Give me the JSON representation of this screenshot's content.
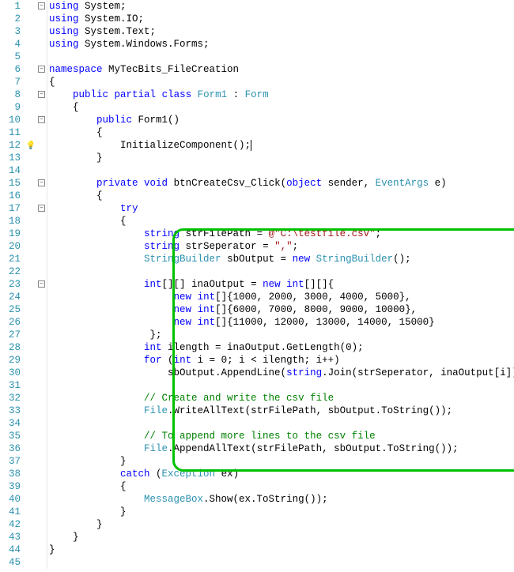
{
  "lines": [
    {
      "n": 1,
      "fold": "-",
      "code": [
        [
          "kw",
          "using"
        ],
        [
          "",
          " System;"
        ]
      ]
    },
    {
      "n": 2,
      "fold": "",
      "code": [
        [
          "kw",
          "using"
        ],
        [
          "",
          " System.IO;"
        ]
      ]
    },
    {
      "n": 3,
      "fold": "",
      "code": [
        [
          "kw",
          "using"
        ],
        [
          "",
          " System.Text;"
        ]
      ]
    },
    {
      "n": 4,
      "fold": "",
      "code": [
        [
          "kw",
          "using"
        ],
        [
          "",
          " System.Windows.Forms;"
        ]
      ]
    },
    {
      "n": 5,
      "fold": "",
      "code": [
        [
          "",
          ""
        ]
      ]
    },
    {
      "n": 6,
      "fold": "-",
      "code": [
        [
          "kw",
          "namespace"
        ],
        [
          "",
          " MyTecBits_FileCreation"
        ]
      ]
    },
    {
      "n": 7,
      "fold": "",
      "code": [
        [
          "",
          "{"
        ]
      ]
    },
    {
      "n": 8,
      "fold": "-",
      "code": [
        [
          "",
          "    "
        ],
        [
          "kw",
          "public"
        ],
        [
          "",
          " "
        ],
        [
          "kw",
          "partial"
        ],
        [
          "",
          " "
        ],
        [
          "kw",
          "class"
        ],
        [
          "",
          " "
        ],
        [
          "type",
          "Form1"
        ],
        [
          "",
          " : "
        ],
        [
          "type",
          "Form"
        ]
      ]
    },
    {
      "n": 9,
      "fold": "",
      "code": [
        [
          "",
          "    {"
        ]
      ]
    },
    {
      "n": 10,
      "fold": "-",
      "code": [
        [
          "",
          "        "
        ],
        [
          "kw",
          "public"
        ],
        [
          "",
          " Form1()"
        ]
      ]
    },
    {
      "n": 11,
      "fold": "",
      "code": [
        [
          "",
          "        {"
        ]
      ]
    },
    {
      "n": 12,
      "fold": "",
      "marker": "bulb",
      "code": [
        [
          "",
          "            InitializeComponent();"
        ],
        [
          "caret",
          ""
        ]
      ]
    },
    {
      "n": 13,
      "fold": "",
      "code": [
        [
          "",
          "        }"
        ]
      ]
    },
    {
      "n": 14,
      "fold": "",
      "code": [
        [
          "",
          ""
        ]
      ]
    },
    {
      "n": 15,
      "fold": "-",
      "code": [
        [
          "",
          "        "
        ],
        [
          "kw",
          "private"
        ],
        [
          "",
          " "
        ],
        [
          "kw",
          "void"
        ],
        [
          "",
          " btnCreateCsv_Click("
        ],
        [
          "kw",
          "object"
        ],
        [
          "",
          " sender, "
        ],
        [
          "type",
          "EventArgs"
        ],
        [
          "",
          " e)"
        ]
      ]
    },
    {
      "n": 16,
      "fold": "",
      "code": [
        [
          "",
          "        {"
        ]
      ]
    },
    {
      "n": 17,
      "fold": "-",
      "code": [
        [
          "",
          "            "
        ],
        [
          "kw",
          "try"
        ]
      ]
    },
    {
      "n": 18,
      "fold": "",
      "code": [
        [
          "",
          "            {"
        ]
      ]
    },
    {
      "n": 19,
      "fold": "",
      "code": [
        [
          "",
          "                "
        ],
        [
          "kw",
          "string"
        ],
        [
          "",
          " strFilePath = "
        ],
        [
          "str",
          "@\"C:\\testfile.csv\""
        ],
        [
          "",
          ";"
        ]
      ]
    },
    {
      "n": 20,
      "fold": "",
      "code": [
        [
          "",
          "                "
        ],
        [
          "kw",
          "string"
        ],
        [
          "",
          " strSeperator = "
        ],
        [
          "str",
          "\",\""
        ],
        [
          "",
          ";"
        ]
      ]
    },
    {
      "n": 21,
      "fold": "",
      "code": [
        [
          "",
          "                "
        ],
        [
          "type",
          "StringBuilder"
        ],
        [
          "",
          " sbOutput = "
        ],
        [
          "kw",
          "new"
        ],
        [
          "",
          " "
        ],
        [
          "type",
          "StringBuilder"
        ],
        [
          "",
          "();"
        ]
      ]
    },
    {
      "n": 22,
      "fold": "",
      "code": [
        [
          "",
          ""
        ]
      ]
    },
    {
      "n": 23,
      "fold": "-",
      "code": [
        [
          "",
          "                "
        ],
        [
          "kw",
          "int"
        ],
        [
          "",
          "[][] inaOutput = "
        ],
        [
          "kw",
          "new"
        ],
        [
          "",
          " "
        ],
        [
          "kw",
          "int"
        ],
        [
          "",
          "[][]{"
        ]
      ]
    },
    {
      "n": 24,
      "fold": "",
      "code": [
        [
          "",
          "                     "
        ],
        [
          "kw",
          "new"
        ],
        [
          "",
          " "
        ],
        [
          "kw",
          "int"
        ],
        [
          "",
          "[]{1000, 2000, 3000, 4000, 5000},"
        ]
      ]
    },
    {
      "n": 25,
      "fold": "",
      "code": [
        [
          "",
          "                     "
        ],
        [
          "kw",
          "new"
        ],
        [
          "",
          " "
        ],
        [
          "kw",
          "int"
        ],
        [
          "",
          "[]{6000, 7000, 8000, 9000, 10000},"
        ]
      ]
    },
    {
      "n": 26,
      "fold": "",
      "code": [
        [
          "",
          "                     "
        ],
        [
          "kw",
          "new"
        ],
        [
          "",
          " "
        ],
        [
          "kw",
          "int"
        ],
        [
          "",
          "[]{11000, 12000, 13000, 14000, 15000}"
        ]
      ]
    },
    {
      "n": 27,
      "fold": "",
      "code": [
        [
          "",
          "                 };"
        ]
      ]
    },
    {
      "n": 28,
      "fold": "",
      "code": [
        [
          "",
          "                "
        ],
        [
          "kw",
          "int"
        ],
        [
          "",
          " ilength = inaOutput.GetLength(0);"
        ]
      ]
    },
    {
      "n": 29,
      "fold": "",
      "code": [
        [
          "",
          "                "
        ],
        [
          "kw",
          "for"
        ],
        [
          "",
          " ("
        ],
        [
          "kw",
          "int"
        ],
        [
          "",
          " i = 0; i < ilength; i++)"
        ]
      ]
    },
    {
      "n": 30,
      "fold": "",
      "code": [
        [
          "",
          "                    sbOutput.AppendLine("
        ],
        [
          "kw",
          "string"
        ],
        [
          "",
          ".Join(strSeperator, inaOutput[i]));"
        ]
      ]
    },
    {
      "n": 31,
      "fold": "",
      "code": [
        [
          "",
          ""
        ]
      ]
    },
    {
      "n": 32,
      "fold": "",
      "code": [
        [
          "",
          "                "
        ],
        [
          "com",
          "// Create and write the csv file"
        ]
      ]
    },
    {
      "n": 33,
      "fold": "",
      "code": [
        [
          "",
          "                "
        ],
        [
          "type",
          "File"
        ],
        [
          "",
          ".WriteAllText(strFilePath, sbOutput.ToString());"
        ]
      ]
    },
    {
      "n": 34,
      "fold": "",
      "code": [
        [
          "",
          ""
        ]
      ]
    },
    {
      "n": 35,
      "fold": "",
      "code": [
        [
          "",
          "                "
        ],
        [
          "com",
          "// To append more lines to the csv file"
        ]
      ]
    },
    {
      "n": 36,
      "fold": "",
      "code": [
        [
          "",
          "                "
        ],
        [
          "type",
          "File"
        ],
        [
          "",
          ".AppendAllText(strFilePath, sbOutput.ToString());"
        ]
      ]
    },
    {
      "n": 37,
      "fold": "",
      "code": [
        [
          "",
          "            }"
        ]
      ]
    },
    {
      "n": 38,
      "fold": "",
      "code": [
        [
          "",
          "            "
        ],
        [
          "kw",
          "catch"
        ],
        [
          "",
          " ("
        ],
        [
          "type",
          "Exception"
        ],
        [
          "",
          " ex)"
        ]
      ]
    },
    {
      "n": 39,
      "fold": "",
      "code": [
        [
          "",
          "            {"
        ]
      ]
    },
    {
      "n": 40,
      "fold": "",
      "code": [
        [
          "",
          "                "
        ],
        [
          "type",
          "MessageBox"
        ],
        [
          "",
          ".Show(ex.ToString());"
        ]
      ]
    },
    {
      "n": 41,
      "fold": "",
      "code": [
        [
          "",
          "            }"
        ]
      ]
    },
    {
      "n": 42,
      "fold": "",
      "code": [
        [
          "",
          "        }"
        ]
      ]
    },
    {
      "n": 43,
      "fold": "",
      "code": [
        [
          "",
          "    }"
        ]
      ]
    },
    {
      "n": 44,
      "fold": "",
      "code": [
        [
          "",
          "}"
        ]
      ]
    },
    {
      "n": 45,
      "fold": "",
      "code": [
        [
          "",
          ""
        ]
      ]
    }
  ],
  "highlight": {
    "startLine": 19,
    "endLine": 36
  }
}
